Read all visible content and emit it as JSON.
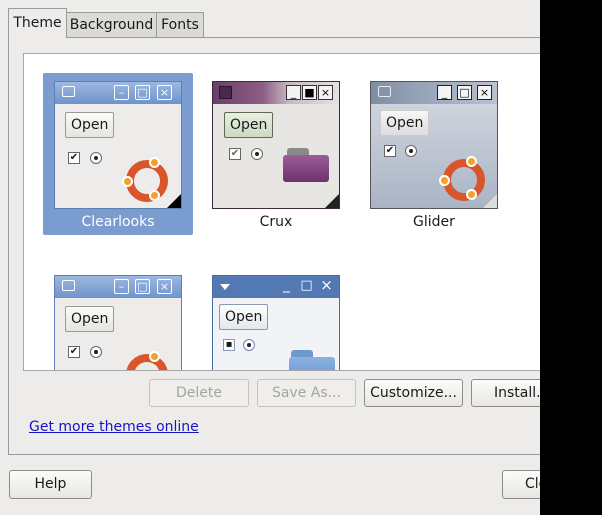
{
  "tabs": [
    {
      "label": "Theme",
      "active": true
    },
    {
      "label": "Background",
      "active": false
    },
    {
      "label": "Fonts",
      "active": false
    }
  ],
  "themes": [
    {
      "name": "Clearlooks",
      "selected": true,
      "open_label": "Open"
    },
    {
      "name": "Crux",
      "selected": false,
      "open_label": "Open"
    },
    {
      "name": "Glider",
      "selected": false,
      "open_label": "Open"
    },
    {
      "name": "",
      "selected": false,
      "open_label": "Open"
    },
    {
      "name": "",
      "selected": false,
      "open_label": "Open"
    }
  ],
  "actions": {
    "delete": "Delete",
    "save_as": "Save As...",
    "customize": "Customize...",
    "install": "Install..."
  },
  "get_more_link": "Get more themes online",
  "footer": {
    "help": "Help",
    "close": "Close"
  },
  "colors": {
    "selection": "#7b9ccf",
    "link": "#1515c8",
    "ubuntu_red": "#d9552c",
    "ubuntu_orange": "#f3a12a"
  }
}
